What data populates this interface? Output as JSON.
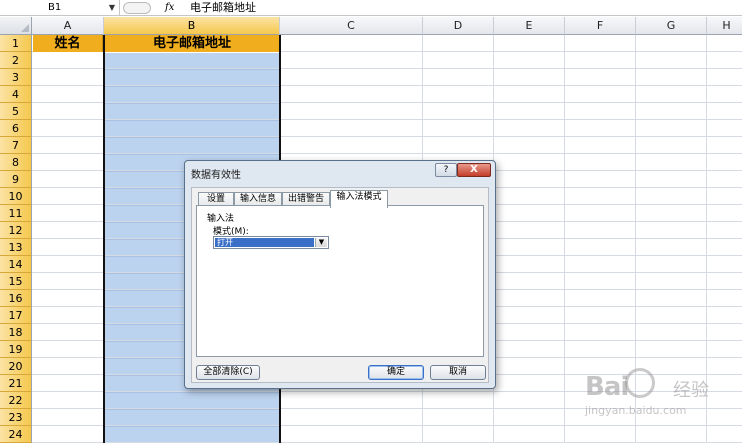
{
  "formula_bar": {
    "name_box": "B1",
    "fx_label": "fx",
    "content": "电子邮箱地址"
  },
  "columns": [
    "A",
    "B",
    "C",
    "D",
    "E",
    "F",
    "G",
    "H"
  ],
  "rows": [
    "1",
    "2",
    "3",
    "4",
    "5",
    "6",
    "7",
    "8",
    "9",
    "10",
    "11",
    "12",
    "13",
    "14",
    "15",
    "16",
    "17",
    "18",
    "19",
    "20",
    "21",
    "22",
    "23",
    "24"
  ],
  "cells": {
    "A1": "姓名",
    "B1": "电子邮箱地址"
  },
  "colors": {
    "header_fill": "#f0ad1e",
    "selection_fill": "#bcd3ef",
    "accent": "#3a6fc7"
  },
  "dialog": {
    "title": "数据有效性",
    "help_button": "?",
    "close_button": "X",
    "tabs": [
      {
        "label": "设置"
      },
      {
        "label": "输入信息"
      },
      {
        "label": "出错警告"
      },
      {
        "label": "输入法模式"
      }
    ],
    "active_tab": "输入法模式",
    "group_label": "输入法",
    "mode_label": "模式(M):",
    "mode_value": "打开",
    "buttons": {
      "clear_all": "全部清除(C)",
      "ok": "确定",
      "cancel": "取消"
    }
  },
  "watermark": {
    "brand": "Bai",
    "brand2": "经验",
    "url": "jingyan.baidu.com"
  }
}
